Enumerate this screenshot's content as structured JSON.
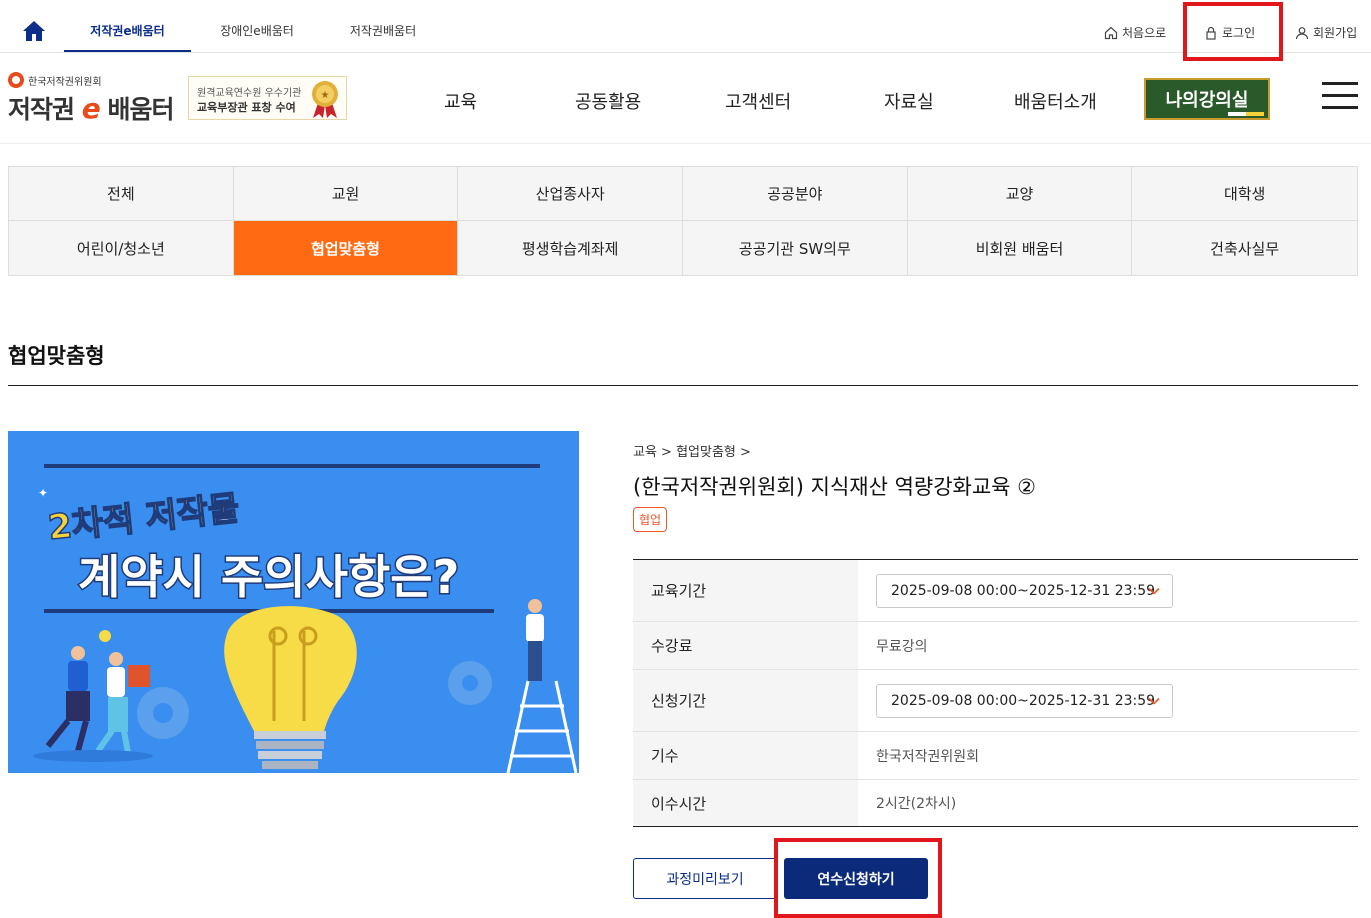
{
  "top_nav": {
    "tabs": [
      {
        "label": "저작권e배움터",
        "active": true
      },
      {
        "label": "장애인e배움터",
        "active": false
      },
      {
        "label": "저작권배움터",
        "active": false
      }
    ],
    "utility": [
      {
        "label": "처음으로",
        "icon": "home-outline-icon"
      },
      {
        "label": "로그인",
        "icon": "lock-icon"
      },
      {
        "label": "회원가입",
        "icon": "person-icon"
      }
    ]
  },
  "header": {
    "org_name": "한국저작권위원회",
    "logo_text_a": "저작권",
    "logo_text_e": "e",
    "logo_text_b": "배움터",
    "award_line1": "원격교육연수원 우수기관",
    "award_line2": "교육부장관 표창 수여",
    "menu": [
      "교육",
      "공동활용",
      "고객센터",
      "자료실",
      "배움터소개"
    ],
    "my_lecture": "나의강의실"
  },
  "categories": [
    {
      "label": "전체",
      "active": false
    },
    {
      "label": "교원",
      "active": false
    },
    {
      "label": "산업종사자",
      "active": false
    },
    {
      "label": "공공분야",
      "active": false
    },
    {
      "label": "교양",
      "active": false
    },
    {
      "label": "대학생",
      "active": false
    },
    {
      "label": "어린이/청소년",
      "active": false
    },
    {
      "label": "협업맞춤형",
      "active": true
    },
    {
      "label": "평생학습계좌제",
      "active": false
    },
    {
      "label": "공공기관 SW의무",
      "active": false
    },
    {
      "label": "비회원 배움터",
      "active": false
    },
    {
      "label": "건축사실무",
      "active": false
    }
  ],
  "page_title": "협업맞춤형",
  "thumbnail": {
    "line1": "2차적 저작물",
    "line2": "계약시 주의사항은?"
  },
  "course": {
    "breadcrumb": "교육 > 협업맞춤형 >",
    "title": "(한국저작권위원회) 지식재산 역량강화교육 ②",
    "badge": "협업",
    "rows": {
      "period_label": "교육기간",
      "period_value": "2025-09-08 00:00~2025-12-31 23:59",
      "fee_label": "수강료",
      "fee_value": "무료강의",
      "apply_label": "신청기간",
      "apply_value": "2025-09-08 00:00~2025-12-31 23:59",
      "cohort_label": "기수",
      "cohort_value": "한국저작권위원회",
      "hours_label": "이수시간",
      "hours_value": "2시간(2차시)"
    },
    "preview_button": "과정미리보기",
    "apply_button": "연수신청하기"
  },
  "colors": {
    "primary": "#0b2e8a",
    "accent": "#ff6a13",
    "highlight": "#e0181b",
    "lecture_bg": "#2a5a2a"
  }
}
